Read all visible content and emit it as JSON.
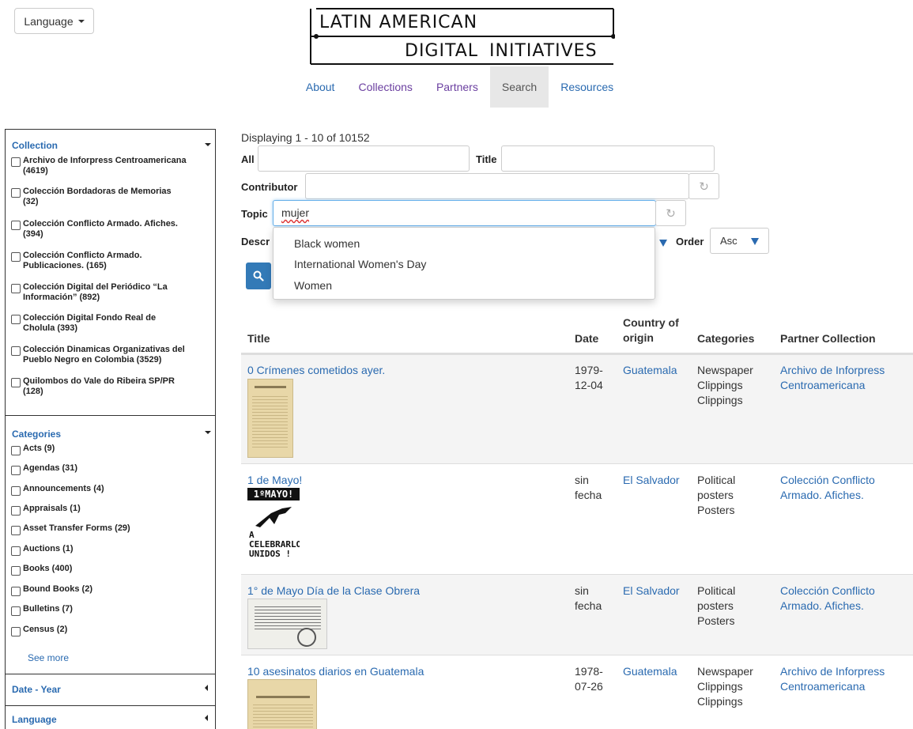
{
  "header": {
    "language_label": "Language",
    "logo_line1": "LATIN AMERICAN",
    "logo_line2": "DIGITAL  INITIATIVES",
    "nav": [
      {
        "label": "About"
      },
      {
        "label": "Collections"
      },
      {
        "label": "Partners"
      },
      {
        "label": "Search"
      },
      {
        "label": "Resources"
      }
    ]
  },
  "sidebar": {
    "collection": {
      "title": "Collection",
      "items": [
        {
          "l1": "Archivo de Inforpress Centroamericana",
          "l2": "(4619)"
        },
        {
          "l1": "Colección Bordadoras de Memorias",
          "l2": "(32)"
        },
        {
          "l1": "Colección Conflicto Armado. Afiches.",
          "l2": "(394)"
        },
        {
          "l1": "Colección Conflicto Armado.",
          "l2": "Publicaciones. (165)"
        },
        {
          "l1": "Colección Digital del Periódico “La",
          "l2": "Información” (892)"
        },
        {
          "l1": "Colección Digital Fondo Real de",
          "l2": "Cholula (393)"
        },
        {
          "l1": "Colección Dinamicas Organizativas del",
          "l2": "Pueblo Negro en Colombia (3529)"
        },
        {
          "l1": "Quilombos do Vale do Ribeira SP/PR",
          "l2": "(128)"
        }
      ]
    },
    "categories": {
      "title": "Categories",
      "items": [
        {
          "l1": "Acts (9)"
        },
        {
          "l1": "Agendas (31)"
        },
        {
          "l1": "Announcements (4)"
        },
        {
          "l1": "Appraisals (1)"
        },
        {
          "l1": "Asset Transfer Forms (29)"
        },
        {
          "l1": "Auctions (1)"
        },
        {
          "l1": "Books (400)"
        },
        {
          "l1": "Bound Books (2)"
        },
        {
          "l1": "Bulletins (7)"
        },
        {
          "l1": "Census (2)"
        }
      ],
      "see_more": "See more"
    },
    "date_year": "Date - Year",
    "language": "Language"
  },
  "search": {
    "displaying": "Displaying 1 - 10 of 10152",
    "all_label": "All",
    "title_label": "Title",
    "contributor_label": "Contributor",
    "topic_label": "Topic",
    "topic_value": "mujer",
    "description_label": "Descr",
    "order_label": "Order",
    "order_value": "Asc",
    "suggestions": [
      "Black women",
      "International Women's Day",
      "Women"
    ]
  },
  "table": {
    "headers": {
      "title": "Title",
      "date": "Date",
      "country1": "Country of",
      "country2": "origin",
      "categories": "Categories",
      "partner": "Partner Collection"
    },
    "rows": [
      {
        "title": "0 Crímenes cometidos ayer.",
        "date1": "1979-",
        "date2": "12-04",
        "country": "Guatemala",
        "cat1": "Newspaper",
        "cat2": "Clippings",
        "cat3": "Clippings",
        "p1": "Archivo de Inforpress",
        "p2": "Centroamericana"
      },
      {
        "title": "1 de Mayo!",
        "date1": "sin",
        "date2": "fecha",
        "country": "El Salvador",
        "cat1": "Political",
        "cat2": "posters",
        "cat3": "Posters",
        "p1": "Colección Conflicto",
        "p2": "Armado. Afiches.",
        "thumb_text": {
          "t1": "1ºMAYO!",
          "t2": "A",
          "t3": "CELEBRARLO",
          "t4": "UNIDOS !"
        }
      },
      {
        "title": "1° de Mayo Día de la Clase Obrera",
        "date1": "sin",
        "date2": "fecha",
        "country": "El Salvador",
        "cat1": "Political",
        "cat2": "posters",
        "cat3": "Posters",
        "p1": "Colección Conflicto",
        "p2": "Armado. Afiches."
      },
      {
        "title": "10 asesinatos diarios en Guatemala",
        "date1": "1978-",
        "date2": "07-26",
        "country": "Guatemala",
        "cat1": "Newspaper",
        "cat2": "Clippings",
        "cat3": "Clippings",
        "p1": "Archivo de Inforpress",
        "p2": "Centroamericana"
      }
    ]
  }
}
